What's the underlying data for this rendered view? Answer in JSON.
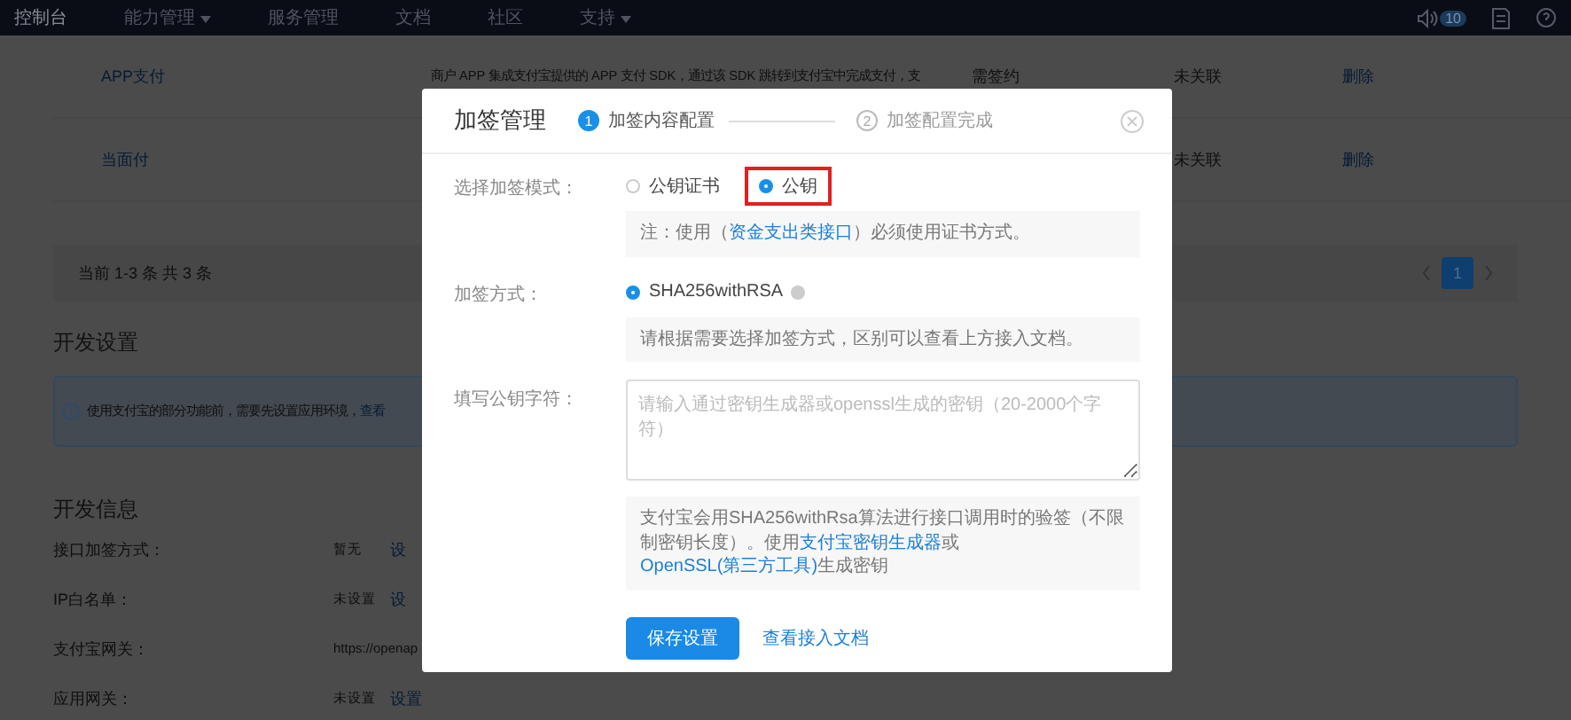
{
  "nav": {
    "items": [
      {
        "label": "控制台",
        "selected": true,
        "dropdown": false
      },
      {
        "label": "能力管理",
        "selected": false,
        "dropdown": true
      },
      {
        "label": "服务管理",
        "selected": false,
        "dropdown": false
      },
      {
        "label": "文档",
        "selected": false,
        "dropdown": false
      },
      {
        "label": "社区",
        "selected": false,
        "dropdown": false
      },
      {
        "label": "支持",
        "selected": false,
        "dropdown": true
      }
    ],
    "badge": "10"
  },
  "table": {
    "rows": [
      {
        "name": "APP支付",
        "description": "商户 APP 集成支付宝提供的 APP 支付 SDK，通过该 SDK 跳转到支付宝中完成支付，支",
        "sign": "需签约",
        "status": "未关联",
        "action": "删除"
      },
      {
        "name": "当面付",
        "status": "未关联",
        "action": "删除"
      }
    ],
    "summary": "当前 1-3 条 共 3 条",
    "pages": [
      {
        "label": "1",
        "selected": true
      }
    ]
  },
  "dev_settings": {
    "title": "开发设置",
    "notice": "使用支付宝的部分功能前，需要先设置应用环境，",
    "notice_link": "查看"
  },
  "dev_info": {
    "title": "开发信息",
    "rows": [
      {
        "label": "接口加签方式：",
        "value": "暂无",
        "action": "设"
      },
      {
        "label": "IP白名单：",
        "value": "未设置",
        "action": "设"
      },
      {
        "label": "支付宝网关：",
        "value": "https://openap"
      },
      {
        "label": "应用网关：",
        "value": "未设置",
        "action": "设置"
      }
    ]
  },
  "dialog": {
    "title": "加签管理",
    "steps": [
      {
        "number": "1",
        "label": "加签内容配置",
        "selected": true
      },
      {
        "number": "2",
        "label": "加签配置完成",
        "selected": false
      }
    ],
    "mode": {
      "label": "选择加签模式：",
      "options": [
        {
          "label": "公钥证书",
          "selected": false,
          "highlighted": false
        },
        {
          "label": "公钥",
          "selected": true,
          "highlighted": true
        }
      ],
      "note": "注：使用（",
      "note_link": "资金支出类接口",
      "note_end": "）必须使用证书方式。"
    },
    "method": {
      "label": "加签方式：",
      "options": [
        {
          "label": "SHA256withRSA",
          "selected": true
        }
      ],
      "note": "请根据需要选择加签方式，区别可以查看上方接入文档。"
    },
    "key": {
      "label": "填写公钥字符：",
      "placeholder": "请输入通过密钥生成器或openssl生成的密钥（20-2000个字符）",
      "note": "支付宝会用SHA256withRsa算法进行接口调用时的验签（不限制密钥长度）。使用",
      "link1": "支付宝密钥生成器",
      "middle": "或",
      "link2": "OpenSSL(第三方工具)",
      "end": "生成密钥"
    },
    "save": "保存设置",
    "doc_link": "查看接入文档"
  }
}
